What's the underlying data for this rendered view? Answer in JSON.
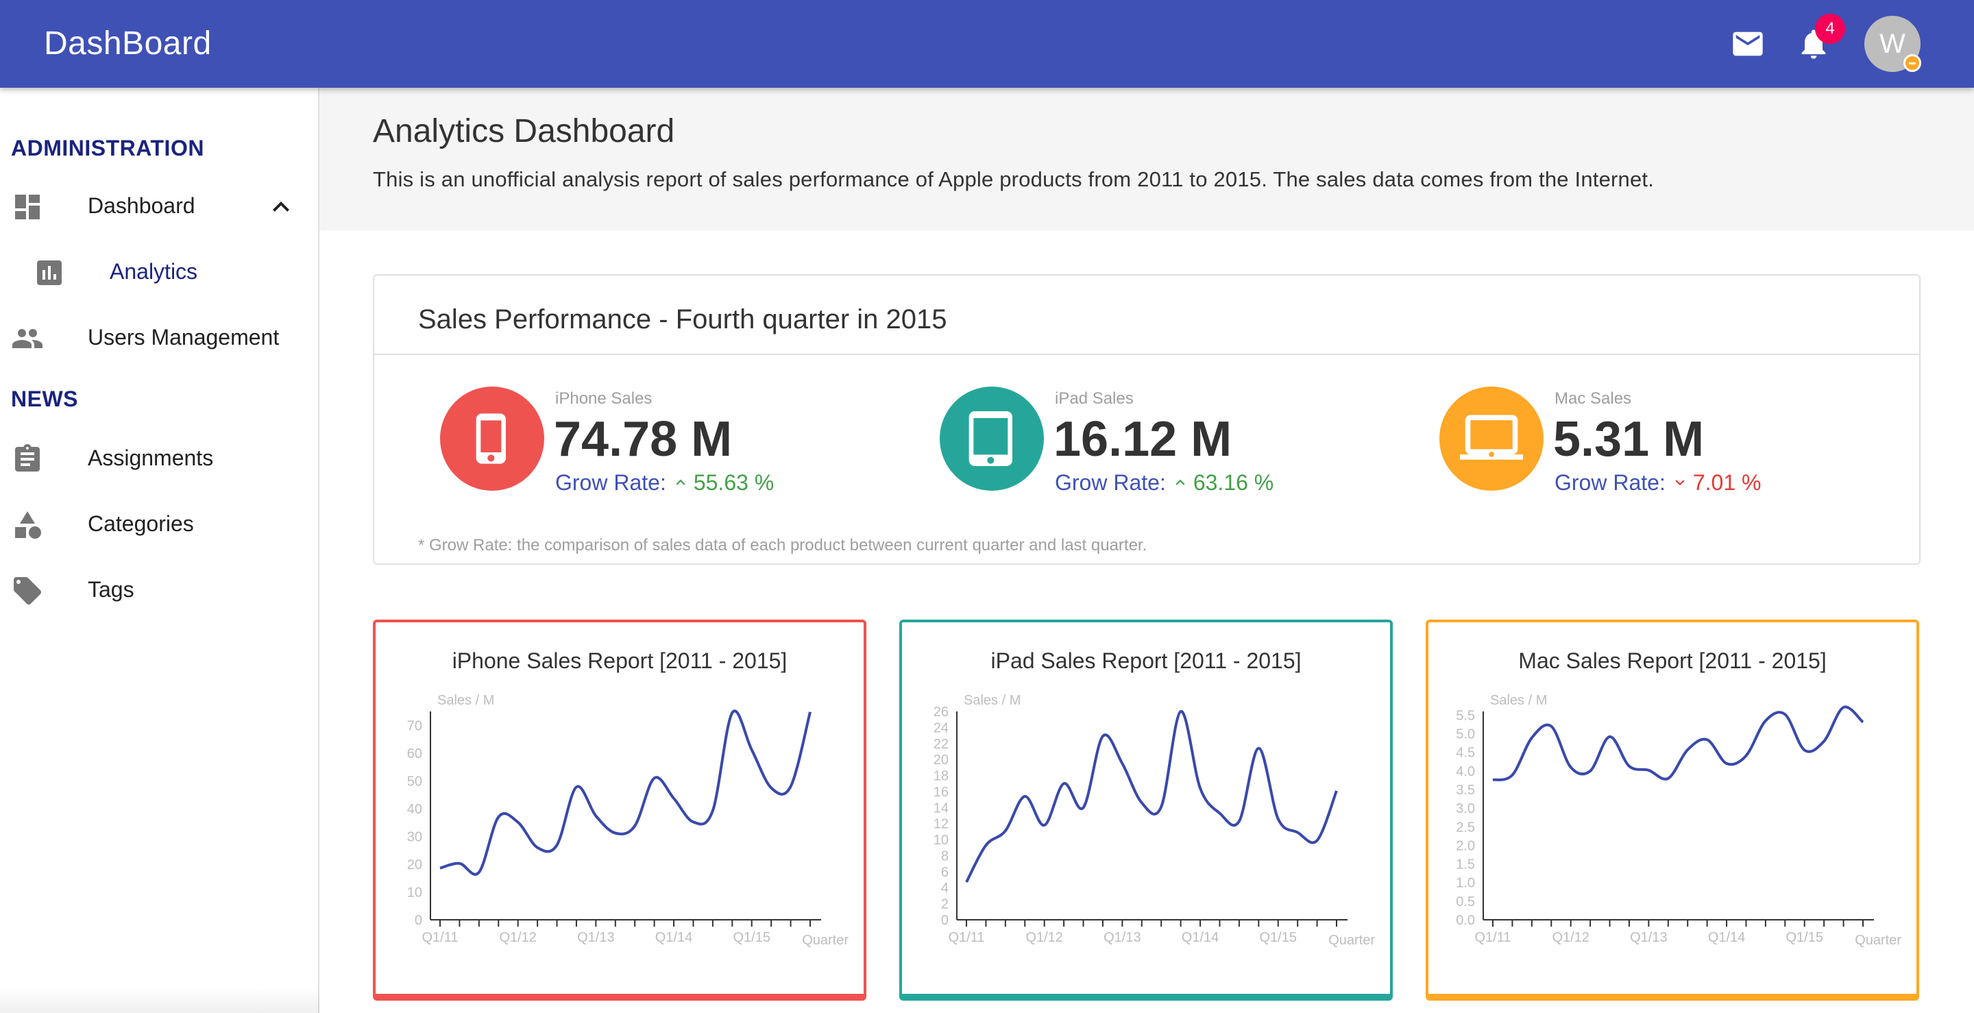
{
  "app": {
    "title": "DashBoard"
  },
  "topbar": {
    "notification_count": "4",
    "avatar_initial": "W"
  },
  "sidebar": {
    "sections": [
      {
        "label": "ADMINISTRATION"
      },
      {
        "label": "NEWS"
      }
    ],
    "items": [
      {
        "label": "Dashboard",
        "icon": "dashboard-icon",
        "expanded": true
      },
      {
        "label": "Analytics",
        "icon": "bar-chart-icon",
        "selected": true
      },
      {
        "label": "Users Management",
        "icon": "people-icon"
      },
      {
        "label": "Assignments",
        "icon": "clipboard-icon"
      },
      {
        "label": "Categories",
        "icon": "shapes-icon"
      },
      {
        "label": "Tags",
        "icon": "tag-icon"
      }
    ]
  },
  "page": {
    "title": "Analytics Dashboard",
    "description": "This is an unofficial analysis report of sales performance of Apple products from 2011 to 2015. The sales data comes from the Internet."
  },
  "performance": {
    "title": "Sales Performance - Fourth quarter in 2015",
    "grow_label": "Grow Rate:",
    "note": "* Grow Rate: the comparison of sales data of each product between current quarter and last quarter.",
    "stats": [
      {
        "label": "iPhone Sales",
        "value": "74.78 M",
        "rate": "55.63 %",
        "direction": "up",
        "color": "#ef5350",
        "icon": "phone-icon"
      },
      {
        "label": "iPad Sales",
        "value": "16.12 M",
        "rate": "63.16 %",
        "direction": "up",
        "color": "#26a69a",
        "icon": "tablet-icon"
      },
      {
        "label": "Mac Sales",
        "value": "5.31 M",
        "rate": "7.01 %",
        "direction": "down",
        "color": "#ffa726",
        "icon": "laptop-icon"
      }
    ]
  },
  "colors": {
    "primary": "#3f51b5",
    "line": "#3949ab",
    "up": "#43a047",
    "down": "#e53935"
  },
  "chart_data": [
    {
      "type": "line",
      "title": "iPhone Sales Report [2011 - 2015]",
      "ylabel": "Sales / M",
      "xlabel": "Quarter",
      "ylim": [
        0,
        75
      ],
      "yticks": [
        0,
        10,
        20,
        30,
        40,
        50,
        60,
        70
      ],
      "xtick_labels": [
        "Q1/11",
        "Q1/12",
        "Q1/13",
        "Q1/14",
        "Q1/15"
      ],
      "border_color": "#ef5350",
      "series": [
        {
          "values": [
            18.6,
            20.3,
            17.1,
            37.0,
            35.1,
            26.0,
            26.9,
            47.8,
            37.4,
            31.2,
            33.8,
            51.0,
            43.7,
            35.2,
            39.3,
            74.5,
            61.2,
            47.5,
            48.0,
            74.8
          ]
        }
      ]
    },
    {
      "type": "line",
      "title": "iPad Sales Report [2011 - 2015]",
      "ylabel": "Sales / M",
      "xlabel": "Quarter",
      "ylim": [
        0,
        26
      ],
      "yticks": [
        0,
        2,
        4,
        6,
        8,
        10,
        12,
        14,
        16,
        18,
        20,
        22,
        24,
        26
      ],
      "xtick_labels": [
        "Q1/11",
        "Q1/12",
        "Q1/13",
        "Q1/14",
        "Q1/15"
      ],
      "border_color": "#26a69a",
      "series": [
        {
          "values": [
            4.7,
            9.3,
            11.1,
            15.4,
            11.8,
            17.0,
            14.0,
            22.9,
            19.5,
            14.6,
            14.1,
            26.0,
            16.4,
            13.3,
            12.3,
            21.4,
            12.6,
            10.9,
            9.9,
            16.1
          ]
        }
      ]
    },
    {
      "type": "line",
      "title": "Mac Sales Report [2011 - 2015]",
      "ylabel": "Sales / M",
      "xlabel": "Quarter",
      "ylim": [
        0,
        5.6
      ],
      "yticks": [
        0.0,
        0.5,
        1.0,
        1.5,
        2.0,
        2.5,
        3.0,
        3.5,
        4.0,
        4.5,
        5.0,
        5.5
      ],
      "xtick_labels": [
        "Q1/11",
        "Q1/12",
        "Q1/13",
        "Q1/14",
        "Q1/15"
      ],
      "border_color": "#ffa726",
      "series": [
        {
          "values": [
            3.76,
            3.89,
            4.89,
            5.2,
            4.1,
            4.0,
            4.92,
            4.13,
            4.02,
            3.8,
            4.57,
            4.84,
            4.2,
            4.41,
            5.35,
            5.52,
            4.56,
            4.8,
            5.71,
            5.31
          ]
        }
      ]
    }
  ]
}
